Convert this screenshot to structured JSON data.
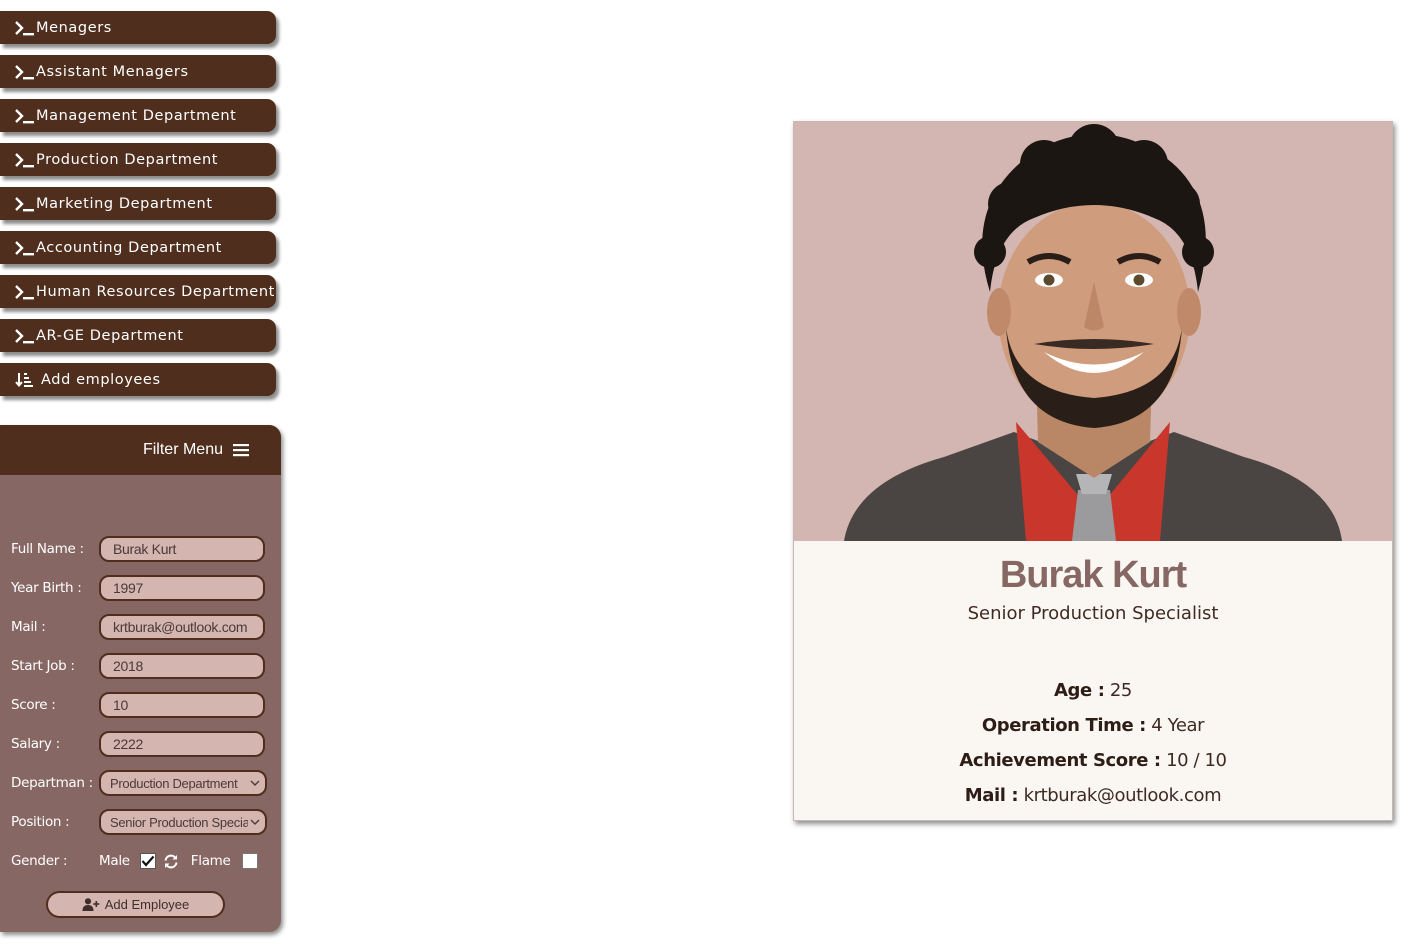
{
  "nav": {
    "items": [
      {
        "label": "Menagers"
      },
      {
        "label": "Assistant Menagers"
      },
      {
        "label": "Management Department"
      },
      {
        "label": "Production Department"
      },
      {
        "label": "Marketing Department"
      },
      {
        "label": "Accounting Department"
      },
      {
        "label": "Human Resources Department"
      },
      {
        "label": "AR-GE Department"
      }
    ],
    "add_employees_label": "Add employees"
  },
  "filter": {
    "title": "Filter Menu",
    "fields": {
      "full_name": {
        "label": "Full Name :",
        "value": "Burak Kurt"
      },
      "year_birth": {
        "label": "Year Birth :",
        "value": "1997"
      },
      "mail": {
        "label": "Mail :",
        "value": "krtburak@outlook.com"
      },
      "start_job": {
        "label": "Start Job :",
        "value": "2018"
      },
      "score": {
        "label": "Score :",
        "value": "10"
      },
      "salary": {
        "label": "Salary :",
        "value": "2222"
      },
      "department": {
        "label": "Departman :",
        "value": "Production Department"
      },
      "position": {
        "label": "Position :",
        "value": "Senior Production Specialist"
      }
    },
    "gender": {
      "label": "Gender :",
      "male_label": "Male",
      "male_checked": true,
      "female_label": "Flame",
      "female_checked": false
    },
    "add_button_label": "Add Employee"
  },
  "card": {
    "name": "Burak Kurt",
    "title": "Senior Production Specialist",
    "age_label": "Age :",
    "age_value": "25",
    "operation_label": "Operation Time :",
    "operation_value": "4 Year",
    "score_label": "Achievement Score :",
    "score_value": "10 / 10",
    "mail_label": "Mail :",
    "mail_value": "krtburak@outlook.com"
  },
  "colors": {
    "nav_bg": "#4f2e1e",
    "panel_bg": "#876764",
    "input_bg": "#d4b5b0",
    "photo_bg": "#d3b5b1",
    "card_bg": "#faf7f3",
    "name_color": "#866763"
  },
  "icons": {
    "nav_item": "terminal-icon",
    "add_employees": "sort-down-icon",
    "filter_menu": "hamburger-icon",
    "gender_toggle": "refresh-icon",
    "add_employee": "user-plus-icon"
  }
}
